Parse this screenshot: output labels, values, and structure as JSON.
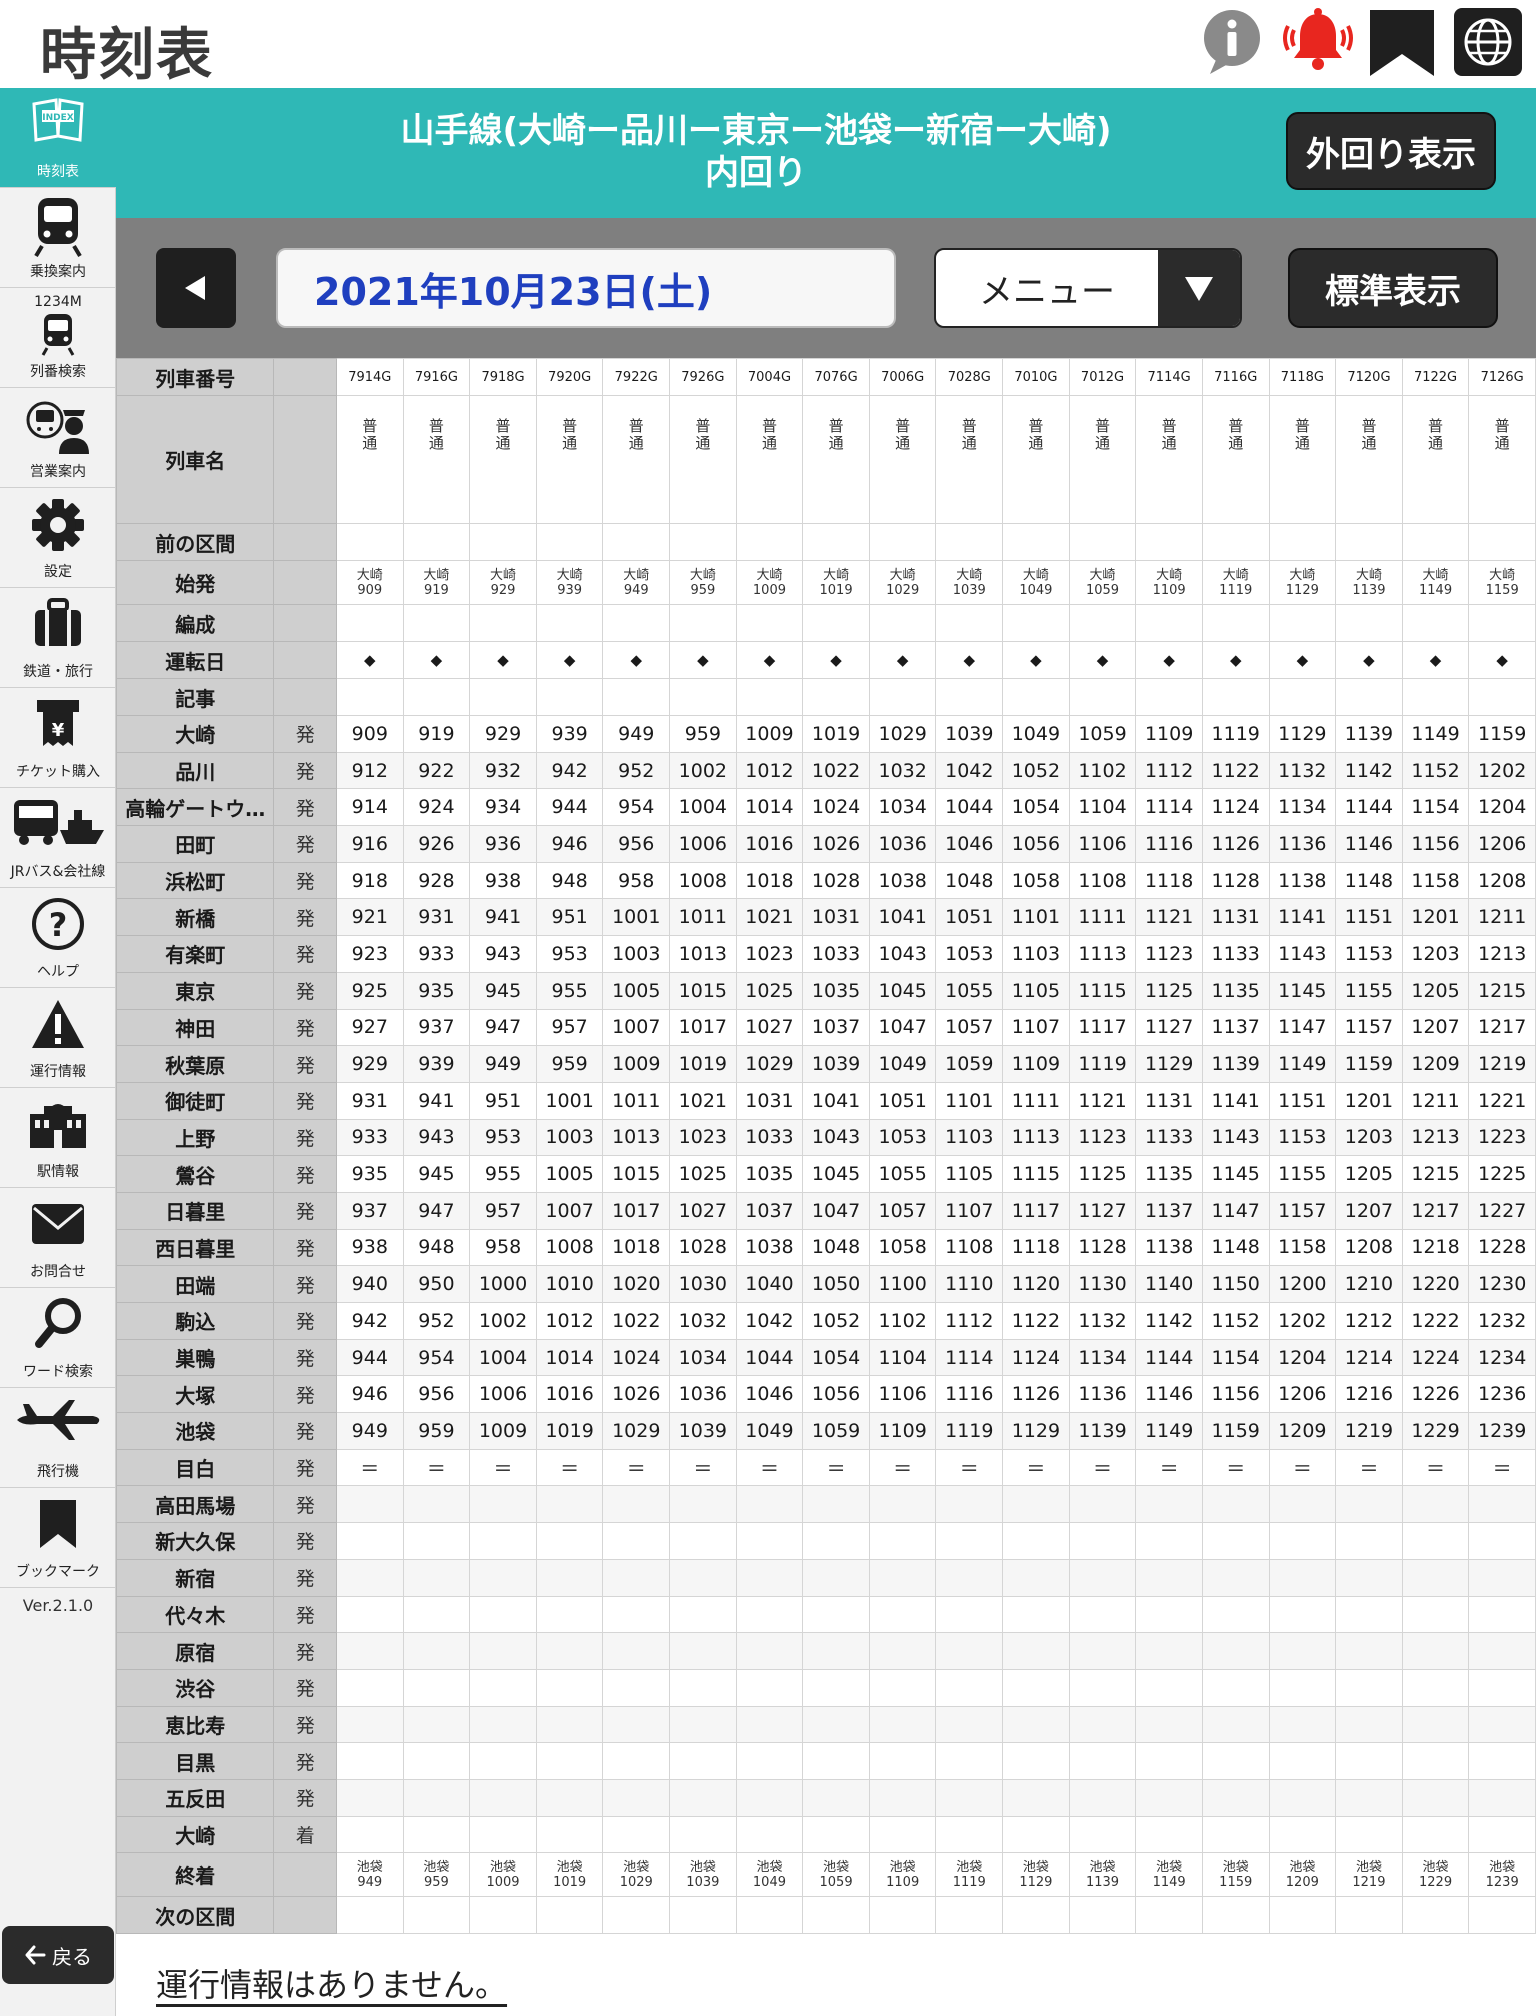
{
  "app": {
    "title": "時刻表",
    "top_icons": [
      "info-icon",
      "alarm-bell-icon",
      "bookmark-icon",
      "globe-icon"
    ],
    "brand_color": "#2fb8b6"
  },
  "sidebar": {
    "items": [
      {
        "label": "時刻表",
        "icon": "index-book-icon",
        "active": true
      },
      {
        "label": "乗換案内",
        "icon": "train-icon"
      },
      {
        "label": "列番検索",
        "icon": "train-number-icon",
        "top_text": "1234M"
      },
      {
        "label": "営業案内",
        "icon": "staff-icon"
      },
      {
        "label": "設定",
        "icon": "gear-icon"
      },
      {
        "label": "鉄道・旅行",
        "icon": "suitcase-icon"
      },
      {
        "label": "チケット購入",
        "icon": "ticket-icon"
      },
      {
        "label": "JRバス&会社線",
        "icon": "bus-ship-icon"
      },
      {
        "label": "ヘルプ",
        "icon": "help-icon"
      },
      {
        "label": "運行情報",
        "icon": "warning-icon"
      },
      {
        "label": "駅情報",
        "icon": "station-icon"
      },
      {
        "label": "お問合せ",
        "icon": "mail-icon"
      },
      {
        "label": "ワード検索",
        "icon": "search-icon"
      },
      {
        "label": "飛行機",
        "icon": "airplane-icon"
      },
      {
        "label": "ブックマーク",
        "icon": "bookmark-icon"
      }
    ],
    "version": "Ver.2.1.0",
    "back_label": "戻る"
  },
  "header": {
    "line_name": "山手線(大崎ー品川ー東京ー池袋ー新宿ー大崎)",
    "direction": "内回り",
    "outer_button": "外回り表示"
  },
  "controls": {
    "date": "2021年10月23日(土)",
    "menu_label": "メニュー",
    "standard_button": "標準表示"
  },
  "timetable": {
    "row_labels": {
      "train_number": "列車番号",
      "train_name": "列車名",
      "prev_section": "前の区間",
      "origin": "始発",
      "formation": "編成",
      "operation_day": "運転日",
      "notes": "記事",
      "terminal": "終着",
      "next_section": "次の区間"
    },
    "depart_mark": "発",
    "arrive_mark": "着",
    "day_mark": "◆",
    "pass_mark": "＝",
    "trains": [
      {
        "number": "7914G",
        "name": "普通",
        "origin": "大崎",
        "origin_time": "909",
        "dest": "池袋",
        "dest_time": "949"
      },
      {
        "number": "7916G",
        "name": "普通",
        "origin": "大崎",
        "origin_time": "919",
        "dest": "池袋",
        "dest_time": "959"
      },
      {
        "number": "7918G",
        "name": "普通",
        "origin": "大崎",
        "origin_time": "929",
        "dest": "池袋",
        "dest_time": "1009"
      },
      {
        "number": "7920G",
        "name": "普通",
        "origin": "大崎",
        "origin_time": "939",
        "dest": "池袋",
        "dest_time": "1019"
      },
      {
        "number": "7922G",
        "name": "普通",
        "origin": "大崎",
        "origin_time": "949",
        "dest": "池袋",
        "dest_time": "1029"
      },
      {
        "number": "7926G",
        "name": "普通",
        "origin": "大崎",
        "origin_time": "959",
        "dest": "池袋",
        "dest_time": "1039"
      },
      {
        "number": "7004G",
        "name": "普通",
        "origin": "大崎",
        "origin_time": "1009",
        "dest": "池袋",
        "dest_time": "1049"
      },
      {
        "number": "7076G",
        "name": "普通",
        "origin": "大崎",
        "origin_time": "1019",
        "dest": "池袋",
        "dest_time": "1059"
      },
      {
        "number": "7006G",
        "name": "普通",
        "origin": "大崎",
        "origin_time": "1029",
        "dest": "池袋",
        "dest_time": "1109"
      },
      {
        "number": "7028G",
        "name": "普通",
        "origin": "大崎",
        "origin_time": "1039",
        "dest": "池袋",
        "dest_time": "1119"
      },
      {
        "number": "7010G",
        "name": "普通",
        "origin": "大崎",
        "origin_time": "1049",
        "dest": "池袋",
        "dest_time": "1129"
      },
      {
        "number": "7012G",
        "name": "普通",
        "origin": "大崎",
        "origin_time": "1059",
        "dest": "池袋",
        "dest_time": "1139"
      },
      {
        "number": "7114G",
        "name": "普通",
        "origin": "大崎",
        "origin_time": "1109",
        "dest": "池袋",
        "dest_time": "1149"
      },
      {
        "number": "7116G",
        "name": "普通",
        "origin": "大崎",
        "origin_time": "1119",
        "dest": "池袋",
        "dest_time": "1159"
      },
      {
        "number": "7118G",
        "name": "普通",
        "origin": "大崎",
        "origin_time": "1129",
        "dest": "池袋",
        "dest_time": "1209"
      },
      {
        "number": "7120G",
        "name": "普通",
        "origin": "大崎",
        "origin_time": "1139",
        "dest": "池袋",
        "dest_time": "1219"
      },
      {
        "number": "7122G",
        "name": "普通",
        "origin": "大崎",
        "origin_time": "1149",
        "dest": "池袋",
        "dest_time": "1229"
      },
      {
        "number": "7126G",
        "name": "普通",
        "origin": "大崎",
        "origin_time": "1159",
        "dest": "池袋",
        "dest_time": "1239"
      }
    ],
    "stations": [
      {
        "name": "大崎",
        "mark": "発",
        "times": [
          "909",
          "919",
          "929",
          "939",
          "949",
          "959",
          "1009",
          "1019",
          "1029",
          "1039",
          "1049",
          "1059",
          "1109",
          "1119",
          "1129",
          "1139",
          "1149",
          "1159"
        ]
      },
      {
        "name": "品川",
        "mark": "発",
        "times": [
          "912",
          "922",
          "932",
          "942",
          "952",
          "1002",
          "1012",
          "1022",
          "1032",
          "1042",
          "1052",
          "1102",
          "1112",
          "1122",
          "1132",
          "1142",
          "1152",
          "1202"
        ]
      },
      {
        "name": "高輪ゲートウ…",
        "mark": "発",
        "times": [
          "914",
          "924",
          "934",
          "944",
          "954",
          "1004",
          "1014",
          "1024",
          "1034",
          "1044",
          "1054",
          "1104",
          "1114",
          "1124",
          "1134",
          "1144",
          "1154",
          "1204"
        ]
      },
      {
        "name": "田町",
        "mark": "発",
        "times": [
          "916",
          "926",
          "936",
          "946",
          "956",
          "1006",
          "1016",
          "1026",
          "1036",
          "1046",
          "1056",
          "1106",
          "1116",
          "1126",
          "1136",
          "1146",
          "1156",
          "1206"
        ]
      },
      {
        "name": "浜松町",
        "mark": "発",
        "times": [
          "918",
          "928",
          "938",
          "948",
          "958",
          "1008",
          "1018",
          "1028",
          "1038",
          "1048",
          "1058",
          "1108",
          "1118",
          "1128",
          "1138",
          "1148",
          "1158",
          "1208"
        ]
      },
      {
        "name": "新橋",
        "mark": "発",
        "times": [
          "921",
          "931",
          "941",
          "951",
          "1001",
          "1011",
          "1021",
          "1031",
          "1041",
          "1051",
          "1101",
          "1111",
          "1121",
          "1131",
          "1141",
          "1151",
          "1201",
          "1211"
        ]
      },
      {
        "name": "有楽町",
        "mark": "発",
        "times": [
          "923",
          "933",
          "943",
          "953",
          "1003",
          "1013",
          "1023",
          "1033",
          "1043",
          "1053",
          "1103",
          "1113",
          "1123",
          "1133",
          "1143",
          "1153",
          "1203",
          "1213"
        ]
      },
      {
        "name": "東京",
        "mark": "発",
        "times": [
          "925",
          "935",
          "945",
          "955",
          "1005",
          "1015",
          "1025",
          "1035",
          "1045",
          "1055",
          "1105",
          "1115",
          "1125",
          "1135",
          "1145",
          "1155",
          "1205",
          "1215"
        ]
      },
      {
        "name": "神田",
        "mark": "発",
        "times": [
          "927",
          "937",
          "947",
          "957",
          "1007",
          "1017",
          "1027",
          "1037",
          "1047",
          "1057",
          "1107",
          "1117",
          "1127",
          "1137",
          "1147",
          "1157",
          "1207",
          "1217"
        ]
      },
      {
        "name": "秋葉原",
        "mark": "発",
        "times": [
          "929",
          "939",
          "949",
          "959",
          "1009",
          "1019",
          "1029",
          "1039",
          "1049",
          "1059",
          "1109",
          "1119",
          "1129",
          "1139",
          "1149",
          "1159",
          "1209",
          "1219"
        ]
      },
      {
        "name": "御徒町",
        "mark": "発",
        "times": [
          "931",
          "941",
          "951",
          "1001",
          "1011",
          "1021",
          "1031",
          "1041",
          "1051",
          "1101",
          "1111",
          "1121",
          "1131",
          "1141",
          "1151",
          "1201",
          "1211",
          "1221"
        ]
      },
      {
        "name": "上野",
        "mark": "発",
        "times": [
          "933",
          "943",
          "953",
          "1003",
          "1013",
          "1023",
          "1033",
          "1043",
          "1053",
          "1103",
          "1113",
          "1123",
          "1133",
          "1143",
          "1153",
          "1203",
          "1213",
          "1223"
        ]
      },
      {
        "name": "鶯谷",
        "mark": "発",
        "times": [
          "935",
          "945",
          "955",
          "1005",
          "1015",
          "1025",
          "1035",
          "1045",
          "1055",
          "1105",
          "1115",
          "1125",
          "1135",
          "1145",
          "1155",
          "1205",
          "1215",
          "1225"
        ]
      },
      {
        "name": "日暮里",
        "mark": "発",
        "times": [
          "937",
          "947",
          "957",
          "1007",
          "1017",
          "1027",
          "1037",
          "1047",
          "1057",
          "1107",
          "1117",
          "1127",
          "1137",
          "1147",
          "1157",
          "1207",
          "1217",
          "1227"
        ]
      },
      {
        "name": "西日暮里",
        "mark": "発",
        "times": [
          "938",
          "948",
          "958",
          "1008",
          "1018",
          "1028",
          "1038",
          "1048",
          "1058",
          "1108",
          "1118",
          "1128",
          "1138",
          "1148",
          "1158",
          "1208",
          "1218",
          "1228"
        ]
      },
      {
        "name": "田端",
        "mark": "発",
        "times": [
          "940",
          "950",
          "1000",
          "1010",
          "1020",
          "1030",
          "1040",
          "1050",
          "1100",
          "1110",
          "1120",
          "1130",
          "1140",
          "1150",
          "1200",
          "1210",
          "1220",
          "1230"
        ]
      },
      {
        "name": "駒込",
        "mark": "発",
        "times": [
          "942",
          "952",
          "1002",
          "1012",
          "1022",
          "1032",
          "1042",
          "1052",
          "1102",
          "1112",
          "1122",
          "1132",
          "1142",
          "1152",
          "1202",
          "1212",
          "1222",
          "1232"
        ]
      },
      {
        "name": "巣鴨",
        "mark": "発",
        "times": [
          "944",
          "954",
          "1004",
          "1014",
          "1024",
          "1034",
          "1044",
          "1054",
          "1104",
          "1114",
          "1124",
          "1134",
          "1144",
          "1154",
          "1204",
          "1214",
          "1224",
          "1234"
        ]
      },
      {
        "name": "大塚",
        "mark": "発",
        "times": [
          "946",
          "956",
          "1006",
          "1016",
          "1026",
          "1036",
          "1046",
          "1056",
          "1106",
          "1116",
          "1126",
          "1136",
          "1146",
          "1156",
          "1206",
          "1216",
          "1226",
          "1236"
        ]
      },
      {
        "name": "池袋",
        "mark": "発",
        "times": [
          "949",
          "959",
          "1009",
          "1019",
          "1029",
          "1039",
          "1049",
          "1059",
          "1109",
          "1119",
          "1129",
          "1139",
          "1149",
          "1159",
          "1209",
          "1219",
          "1229",
          "1239"
        ]
      },
      {
        "name": "目白",
        "mark": "発",
        "times": [
          "＝",
          "＝",
          "＝",
          "＝",
          "＝",
          "＝",
          "＝",
          "＝",
          "＝",
          "＝",
          "＝",
          "＝",
          "＝",
          "＝",
          "＝",
          "＝",
          "＝",
          "＝"
        ]
      },
      {
        "name": "高田馬場",
        "mark": "発",
        "times": []
      },
      {
        "name": "新大久保",
        "mark": "発",
        "times": []
      },
      {
        "name": "新宿",
        "mark": "発",
        "times": []
      },
      {
        "name": "代々木",
        "mark": "発",
        "times": []
      },
      {
        "name": "原宿",
        "mark": "発",
        "times": []
      },
      {
        "name": "渋谷",
        "mark": "発",
        "times": []
      },
      {
        "name": "恵比寿",
        "mark": "発",
        "times": []
      },
      {
        "name": "目黒",
        "mark": "発",
        "times": []
      },
      {
        "name": "五反田",
        "mark": "発",
        "times": []
      },
      {
        "name": "大崎",
        "mark": "着",
        "times": []
      }
    ]
  },
  "status": {
    "message": "運行情報はありません。"
  }
}
